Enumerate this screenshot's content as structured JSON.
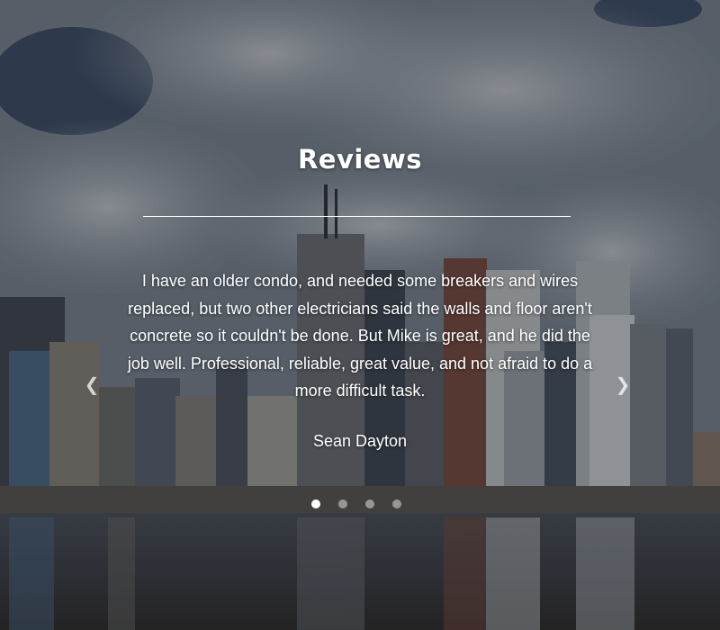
{
  "reviews": {
    "title": "Reviews",
    "quote": "I have an older condo, and needed some breakers and wires replaced, but two other electricians said the walls and floor aren't concrete so it couldn't be done. But Mike is great, and he did the job well. Professional, reliable, great value, and not afraid to do a more difficult task.",
    "author": "Sean Dayton",
    "prev_icon": "chevron-left-icon",
    "next_icon": "chevron-right-icon",
    "pagination": {
      "count": 4,
      "active_index": 0
    }
  },
  "background": {
    "description_icon": "city-skyline-image"
  }
}
